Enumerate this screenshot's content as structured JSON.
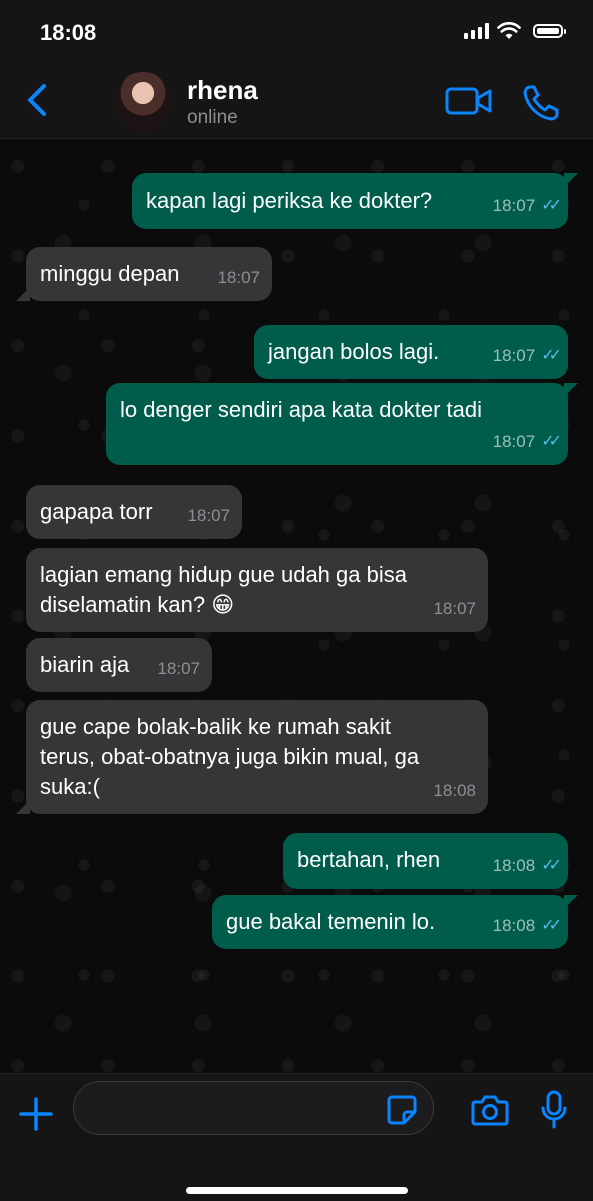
{
  "status_bar": {
    "time": "18:08"
  },
  "header": {
    "contact_name": "rhena",
    "contact_status": "online"
  },
  "messages": [
    {
      "direction": "out",
      "text": "kapan lagi periksa ke dokter?",
      "time": "18:07",
      "read": true
    },
    {
      "direction": "in",
      "text": "minggu depan",
      "time": "18:07"
    },
    {
      "direction": "out",
      "text": "jangan bolos lagi.",
      "time": "18:07",
      "read": true
    },
    {
      "direction": "out",
      "text": "lo denger sendiri apa kata dokter tadi",
      "time": "18:07",
      "read": true
    },
    {
      "direction": "in",
      "text": "gapapa torr",
      "time": "18:07"
    },
    {
      "direction": "in",
      "text": "lagian emang hidup gue udah ga bisa\ndiselamatin kan? 😁",
      "time": "18:07"
    },
    {
      "direction": "in",
      "text": "biarin aja",
      "time": "18:07"
    },
    {
      "direction": "in",
      "text": "gue cape bolak-balik ke rumah sakit\nterus, obat-obatnya juga bikin mual, ga\nsuka:(",
      "time": "18:08"
    },
    {
      "direction": "out",
      "text": "bertahan, rhen",
      "time": "18:08",
      "read": true
    },
    {
      "direction": "out",
      "text": "gue bakal temenin lo.",
      "time": "18:08",
      "read": true
    }
  ],
  "input": {
    "value": ""
  },
  "icons": {
    "back": "chevron-left-icon",
    "video": "video-call-icon",
    "phone": "phone-icon",
    "plus": "plus-icon",
    "sticker": "sticker-icon",
    "camera": "camera-icon",
    "mic": "microphone-icon"
  },
  "colors": {
    "accent": "#0a84ff",
    "outgoing_bubble": "#005c4b",
    "incoming_bubble": "#363638",
    "read_check": "#53bdeb"
  }
}
